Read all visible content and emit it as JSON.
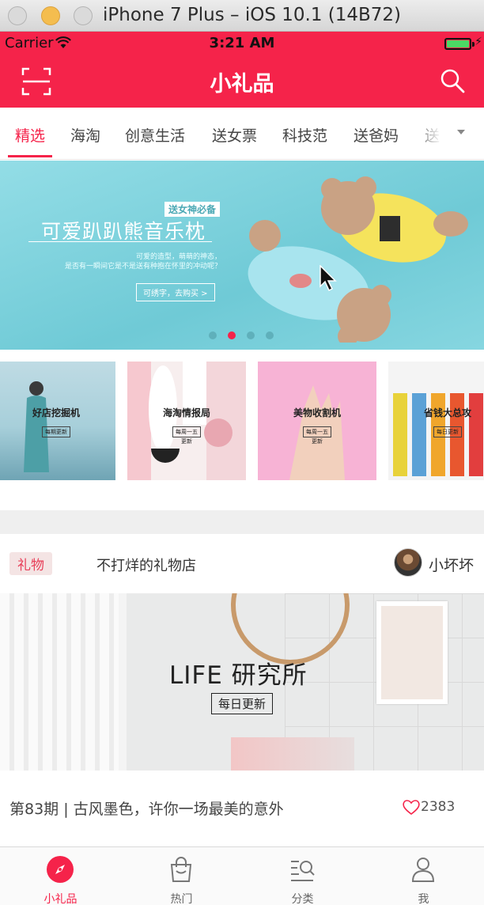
{
  "simulator": {
    "title": "iPhone 7 Plus – iOS 10.1 (14B72)"
  },
  "status_bar": {
    "carrier": "Carrier",
    "time": "3:21 AM"
  },
  "navbar": {
    "title": "小礼品",
    "scan_icon": "scan-icon",
    "search_icon": "search-icon"
  },
  "tabs": [
    "精选",
    "海淘",
    "创意生活",
    "送女票",
    "科技范",
    "送爸妈",
    "送"
  ],
  "active_tab": 0,
  "banner": {
    "tag": "送女神必备",
    "title": "可爱趴趴熊音乐枕",
    "subtitle1": "可爱的造型，萌萌的神态，",
    "subtitle2": "是否有一瞬间它是不是送有种抱在怀里的冲动呢？",
    "button": "可绣字，去购买 >",
    "pages": 4,
    "current_page": 1
  },
  "thumbs": [
    {
      "title": "好店挖掘机",
      "button": "每期更新",
      "color": "#7fb6c2"
    },
    {
      "title": "海淘情报局",
      "button": "每周一五更新",
      "color": "#f1d3d6"
    },
    {
      "title": "美物收割机",
      "button": "每周一五更新",
      "color": "#f5b6d6"
    },
    {
      "title": "省钱大总攻",
      "button": "每日更新",
      "color": "#f4f4f4"
    }
  ],
  "article": {
    "tag": "礼物",
    "shop": "不打烊的礼物店",
    "author": "小坏坏",
    "image_title": "LIFE 研究所",
    "image_badge": "每日更新",
    "caption": "第83期 | 古风墨色，许你一场最美的意外",
    "likes": "2383"
  },
  "tabbar": [
    {
      "label": "小礼品",
      "icon": "compass-icon"
    },
    {
      "label": "热门",
      "icon": "shopping-bag-icon"
    },
    {
      "label": "分类",
      "icon": "category-search-icon"
    },
    {
      "label": "我",
      "icon": "user-icon"
    }
  ],
  "colors": {
    "accent": "#f5234a"
  }
}
